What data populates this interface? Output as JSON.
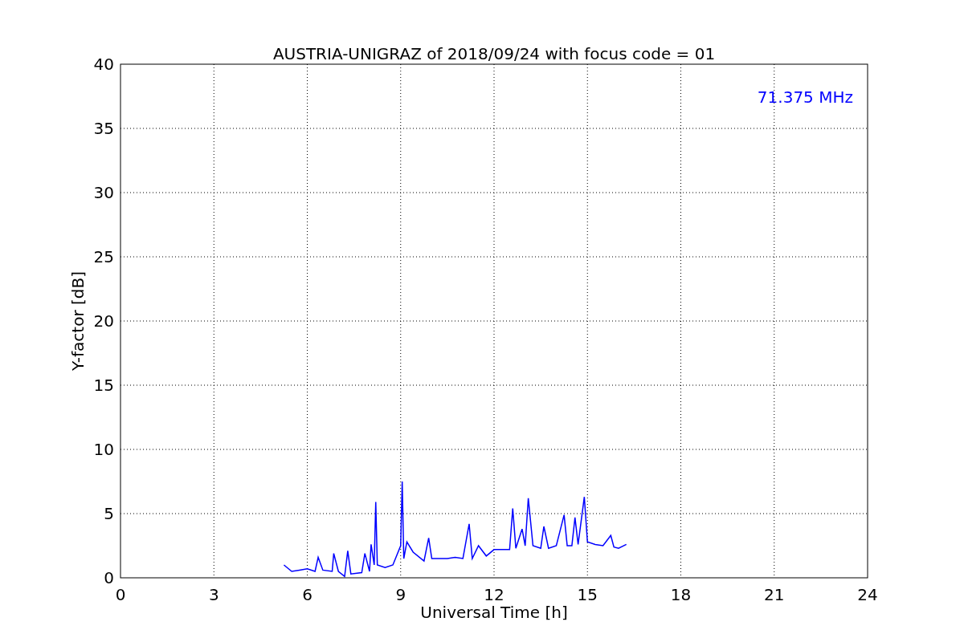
{
  "figure": {
    "chart_data": {
      "type": "line",
      "title": "AUSTRIA-UNIGRAZ of 2018/09/24 with focus code = 01",
      "xlabel": "Universal Time [h]",
      "ylabel": "Y-factor [dB]",
      "x": [
        5.25,
        5.5,
        5.75,
        6.0,
        6.25,
        6.35,
        6.5,
        6.8,
        6.85,
        7.0,
        7.2,
        7.3,
        7.4,
        7.75,
        7.85,
        8.0,
        8.05,
        8.15,
        8.2,
        8.25,
        8.5,
        8.75,
        9.0,
        9.05,
        9.1,
        9.2,
        9.4,
        9.75,
        9.9,
        10.0,
        10.5,
        10.75,
        11.0,
        11.2,
        11.3,
        11.5,
        11.75,
        12.0,
        12.5,
        12.6,
        12.7,
        12.9,
        13.0,
        13.1,
        13.25,
        13.5,
        13.6,
        13.75,
        14.0,
        14.25,
        14.35,
        14.5,
        14.6,
        14.7,
        14.9,
        15.0,
        15.25,
        15.5,
        15.75,
        15.85,
        16.0,
        16.25
      ],
      "series": [
        {
          "name": "71.375 MHz",
          "color": "#0000ff",
          "values": [
            1.0,
            0.5,
            0.6,
            0.7,
            0.5,
            1.6,
            0.6,
            0.5,
            1.9,
            0.5,
            0.1,
            2.1,
            0.3,
            0.4,
            1.9,
            0.5,
            2.6,
            1.0,
            5.9,
            1.0,
            0.8,
            1.0,
            2.5,
            7.5,
            1.5,
            2.8,
            2.0,
            1.3,
            3.1,
            1.5,
            1.5,
            1.6,
            1.5,
            4.2,
            1.5,
            2.5,
            1.7,
            2.2,
            2.2,
            5.4,
            2.3,
            3.8,
            2.5,
            6.2,
            2.5,
            2.3,
            4.0,
            2.3,
            2.5,
            4.9,
            2.5,
            2.5,
            4.7,
            2.6,
            6.3,
            2.8,
            2.6,
            2.5,
            3.3,
            2.4,
            2.3,
            2.6
          ]
        }
      ],
      "xlim": [
        0,
        24
      ],
      "ylim": [
        0,
        40
      ],
      "xticks": [
        0,
        3,
        6,
        9,
        12,
        15,
        18,
        21,
        24
      ],
      "yticks": [
        0,
        5,
        10,
        15,
        20,
        25,
        30,
        35,
        40
      ],
      "grid": true
    }
  }
}
